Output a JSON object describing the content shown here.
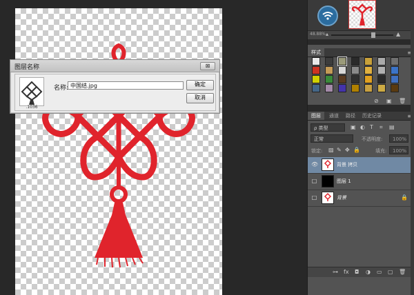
{
  "dialog": {
    "title": "图层名称",
    "close": "⊠",
    "thumb_caption": ".1036",
    "name_label": "名称:",
    "name_value": "中国结.jpg",
    "ok": "确定",
    "cancel": "取消"
  },
  "navigator": {
    "zoom": "48.88%"
  },
  "styles_panel": {
    "tab": "样式",
    "swatch_colors": [
      "#e8e8e8",
      "#3c3c3c",
      "#9a9a7a",
      "#2a2a2a",
      "#c9a13a",
      "#aaaaaa",
      "#707070",
      "#cc3322",
      "#c49b56",
      "#d8d8d8",
      "#8a8a8a",
      "#e0b040",
      "#b0b0b0",
      "#3c74c8",
      "#d0d000",
      "#3a8a3a",
      "#5a3a20",
      "#303030",
      "#e0a020",
      "#2a2a2a",
      "#4070c0",
      "#446688",
      "#a48aa8",
      "#4433aa",
      "#b08000",
      "#c8a040",
      "#ccaa44",
      "#5a3a10"
    ]
  },
  "layers_panel": {
    "tabs": [
      "图层",
      "通道",
      "路径",
      "历史记录"
    ],
    "filter_label": "ρ 类型",
    "blend_mode": "正常",
    "opacity_label": "不透明度:",
    "opacity_value": "100%",
    "lock_label": "锁定:",
    "fill_label": "填充:",
    "fill_value": "100%",
    "layers": [
      {
        "name": "背景 拷贝",
        "visible": true,
        "selected": true
      },
      {
        "name": "图层 1",
        "visible": false,
        "selected": false
      },
      {
        "name": "背景",
        "visible": false,
        "selected": false
      }
    ]
  }
}
